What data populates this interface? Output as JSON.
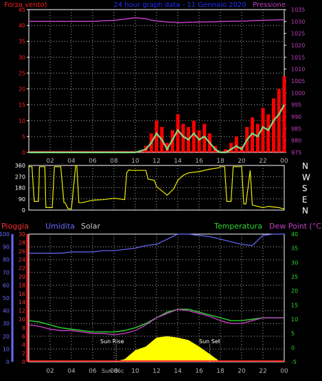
{
  "header": {
    "left_title": "Forza vento)",
    "center_title": "24 hour graph data - 11 Gennaio 2020",
    "right_title": "Pressione"
  },
  "colors": {
    "background": "#000000",
    "grid": "#b4b4b4",
    "axis": "#ffffff",
    "wind_strength": "#ff2020",
    "wind_gust": "#ff0000",
    "wind_avg": "#3bd23b",
    "wind_light": "#c9f0c9",
    "pressure": "#c040c0",
    "direction": "#f0f000",
    "humidity": "#6a6aff",
    "temperature": "#30d830",
    "dewpoint": "#c040c0",
    "solar": "#ffff00",
    "rain": "#ff3030"
  },
  "chart_data": [
    {
      "type": "bar",
      "title": "24 hour graph data - 11 Gennaio 2020",
      "left_axis_label": "Forza vento)",
      "right_axis_label": "Pressione",
      "x_ticks": [
        "02",
        "04",
        "06",
        "08",
        "10",
        "12",
        "14",
        "16",
        "18",
        "20",
        "22",
        "00"
      ],
      "left_ticks": [
        "0",
        "5",
        "10",
        "15",
        "20",
        "25",
        "30",
        "35",
        "40",
        "45"
      ],
      "right_ticks": [
        "975",
        "980",
        "985",
        "990",
        "995",
        "1000",
        "1005",
        "1010",
        "1015",
        "1020",
        "1025",
        "1030",
        "1035"
      ],
      "ylim_left": [
        0,
        45
      ],
      "ylim_right": [
        975,
        1035
      ],
      "x": [
        0,
        1,
        2,
        3,
        4,
        5,
        6,
        7,
        8,
        9,
        10,
        11,
        11.5,
        12,
        12.5,
        13,
        13.5,
        14,
        14.5,
        15,
        15.5,
        16,
        16.5,
        17,
        17.5,
        18,
        18.5,
        19,
        19.5,
        20,
        20.5,
        21,
        21.5,
        22,
        22.5,
        23,
        23.5,
        24
      ],
      "series": [
        {
          "kind": "wind_gust",
          "values": [
            0,
            0,
            0,
            0,
            0,
            0,
            0,
            0,
            0,
            0,
            0,
            2,
            6,
            10,
            8,
            3,
            7,
            12,
            9,
            8,
            10,
            7,
            9,
            6,
            2,
            0,
            1,
            3,
            5,
            2,
            8,
            11,
            9,
            14,
            12,
            17,
            20,
            24
          ]
        },
        {
          "kind": "wind_avg",
          "values": [
            0,
            0,
            0,
            0,
            0,
            0,
            0,
            0,
            0,
            0,
            0,
            1,
            3,
            6,
            4,
            1,
            4,
            7,
            5,
            4,
            6,
            4,
            5,
            3,
            1,
            0,
            0,
            1,
            2,
            1,
            4,
            6,
            5,
            8,
            7,
            10,
            12,
            15
          ]
        },
        {
          "name": "Pressione",
          "kind": "pressure",
          "values": [
            1030,
            1030,
            1030,
            1030,
            1030,
            1030,
            1030,
            1030.3,
            1030.5,
            1031,
            1031.6,
            1031.2,
            1030.6,
            1030.2,
            1030,
            1029.8,
            1029.7,
            1029.6,
            1029.6,
            1029.7,
            1029.7,
            1029.8,
            1029.8,
            1029.9,
            1029.9,
            1030,
            1030,
            1030.1,
            1030.1,
            1030.2,
            1030.2,
            1030.4,
            1030.4,
            1030.5,
            1030.6,
            1030.6,
            1030.7,
            1030.7
          ]
        }
      ]
    },
    {
      "type": "line",
      "y_ticks": [
        "0",
        "90",
        "180",
        "270",
        "360"
      ],
      "compass_labels": [
        "N",
        "W",
        "S",
        "E",
        "N"
      ],
      "ylim": [
        0,
        360
      ],
      "x": [
        0,
        0.3,
        0.5,
        0.9,
        1.0,
        1.5,
        1.6,
        2.2,
        2.4,
        3.0,
        3.3,
        3.4,
        3.7,
        4.0,
        4.4,
        4.5,
        4.7,
        5.0,
        5.5,
        6.0,
        7.0,
        8.0,
        9.0,
        9.2,
        9.4,
        9.6,
        10.0,
        11.0,
        11.2,
        11.8,
        12.0,
        13.0,
        13.6,
        14.0,
        14.5,
        15.0,
        16.0,
        17.0,
        17.8,
        18.0,
        18.4,
        18.6,
        19.0,
        19.2,
        20.0,
        20.2,
        20.4,
        20.8,
        21.0,
        22.0,
        22.5,
        23.0,
        23.5,
        24.0
      ],
      "series": [
        {
          "kind": "direction",
          "values": [
            350,
            350,
            70,
            70,
            350,
            350,
            20,
            20,
            350,
            350,
            60,
            60,
            10,
            10,
            360,
            360,
            60,
            60,
            70,
            80,
            85,
            95,
            85,
            300,
            325,
            320,
            320,
            320,
            250,
            240,
            190,
            120,
            170,
            240,
            280,
            300,
            310,
            330,
            340,
            350,
            350,
            70,
            70,
            350,
            350,
            50,
            50,
            320,
            40,
            20,
            30,
            25,
            20,
            8
          ]
        }
      ]
    },
    {
      "type": "line",
      "labels": {
        "rain": "Pioggia",
        "humidity": "Umidita",
        "solar": "Solar",
        "temperature": "Temperatura",
        "dewpoint": "Dew Point (°C)"
      },
      "annotations": {
        "sunrise": "Sun Rise",
        "sunset": "Sun Set",
        "x_overlap": "Sun 06c"
      },
      "x_ticks": [
        "02",
        "04",
        "06",
        "08",
        "10",
        "12",
        "14",
        "16",
        "18",
        "20",
        "22",
        "00"
      ],
      "humidity_ticks": [
        "0",
        "10",
        "20",
        "30",
        "40",
        "50",
        "60",
        "70",
        "80",
        "90",
        "100"
      ],
      "rain_ticks": [
        "0",
        "2",
        "4",
        "6",
        "8",
        "10",
        "12",
        "14",
        "16",
        "18",
        "20",
        "22",
        "24",
        "26",
        "28",
        "30"
      ],
      "temp_ticks": [
        "-5",
        "0",
        "5",
        "10",
        "15",
        "20",
        "25",
        "30",
        "35",
        "40"
      ],
      "ylim_humidity": [
        0,
        100
      ],
      "ylim_temperature": [
        -5,
        40
      ],
      "x": [
        0,
        1,
        2,
        3,
        4,
        5,
        6,
        7,
        8,
        9,
        10,
        11,
        12,
        13,
        14,
        15,
        16,
        17,
        18,
        19,
        20,
        21,
        22,
        23,
        24
      ],
      "series": [
        {
          "name": "Umidita",
          "kind": "humidity",
          "values": [
            85,
            85,
            85,
            85,
            86,
            86,
            86,
            87,
            87,
            88,
            89,
            91,
            92,
            96,
            100,
            100,
            99,
            98,
            96,
            94,
            92,
            91,
            99,
            100,
            100
          ]
        },
        {
          "name": "Temperatura",
          "kind": "temperature",
          "values": [
            9.5,
            9.0,
            8.0,
            7.0,
            6.5,
            6.0,
            5.5,
            5.5,
            5.5,
            6.0,
            7.0,
            8.5,
            10.5,
            12.5,
            13.5,
            13.5,
            12.5,
            11.5,
            10.5,
            9.5,
            9.5,
            10.0,
            10.5,
            10.5,
            10.5
          ]
        },
        {
          "name": "Dew Point (°C)",
          "kind": "dewpoint",
          "values": [
            8.0,
            7.5,
            6.5,
            6.0,
            6.0,
            5.5,
            5.0,
            5.0,
            4.5,
            5.0,
            6.0,
            8.0,
            10.5,
            12.0,
            13.5,
            13.0,
            12.0,
            11.0,
            9.5,
            8.5,
            8.5,
            9.5,
            10.5,
            10.5,
            10.5
          ]
        },
        {
          "name": "Solar",
          "kind": "solar",
          "values": [
            0,
            0,
            0,
            0,
            0,
            0,
            0,
            0,
            0,
            2,
            9,
            12,
            19,
            20,
            19,
            17,
            12,
            6,
            0,
            0,
            0,
            0,
            0,
            0,
            0
          ]
        },
        {
          "name": "Pioggia",
          "kind": "rain",
          "values": [
            0,
            0,
            0,
            0,
            0,
            0,
            0,
            0,
            0,
            0,
            0,
            0,
            0,
            0,
            0,
            0,
            0,
            0,
            0,
            0,
            0,
            0,
            0,
            0,
            0
          ]
        }
      ]
    }
  ]
}
